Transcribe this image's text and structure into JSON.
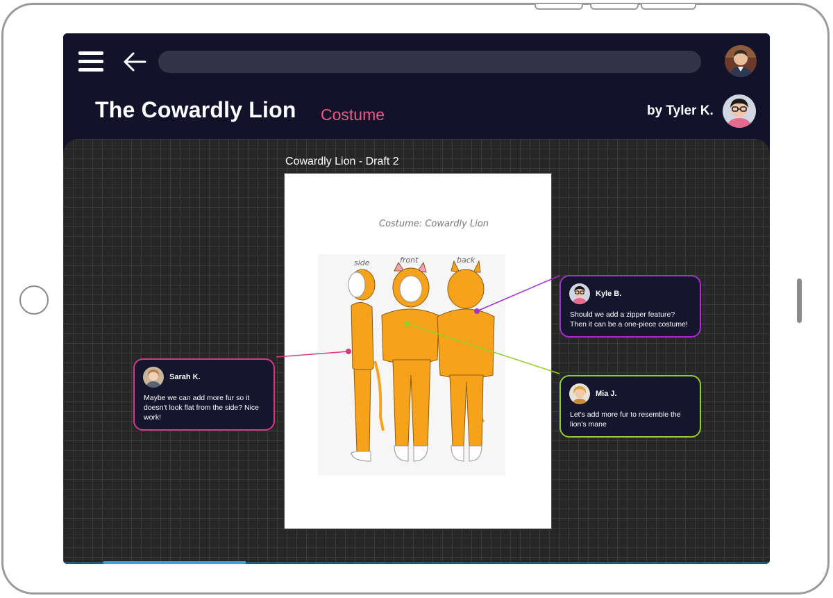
{
  "header": {
    "title": "The Cowardly Lion",
    "category": "Costume",
    "author_label": "by Tyler K.",
    "url_value": ""
  },
  "document": {
    "caption": "Cowardly Lion - Draft 2",
    "sketch_title": "Costume: Cowardly Lion",
    "view_labels": [
      "side",
      "front",
      "back"
    ]
  },
  "comments": [
    {
      "name": "Sarah K.",
      "text": "Maybe we can add more fur so it doesn't look flat from the side? Nice work!",
      "color": "#d43a86"
    },
    {
      "name": "Kyle B.",
      "text": "Should we add a zipper feature? Then it can be a one-piece costume!",
      "color": "#a431c9"
    },
    {
      "name": "Mia J.",
      "text": "Let's add more fur to resemble the lion's mane",
      "color": "#8fd12b"
    }
  ],
  "icons": {
    "menu": "hamburger-icon",
    "back": "arrow-left-icon"
  },
  "colors": {
    "background": "#12122a",
    "accent_pink": "#e95c86",
    "costume_orange": "#f7a21b"
  }
}
